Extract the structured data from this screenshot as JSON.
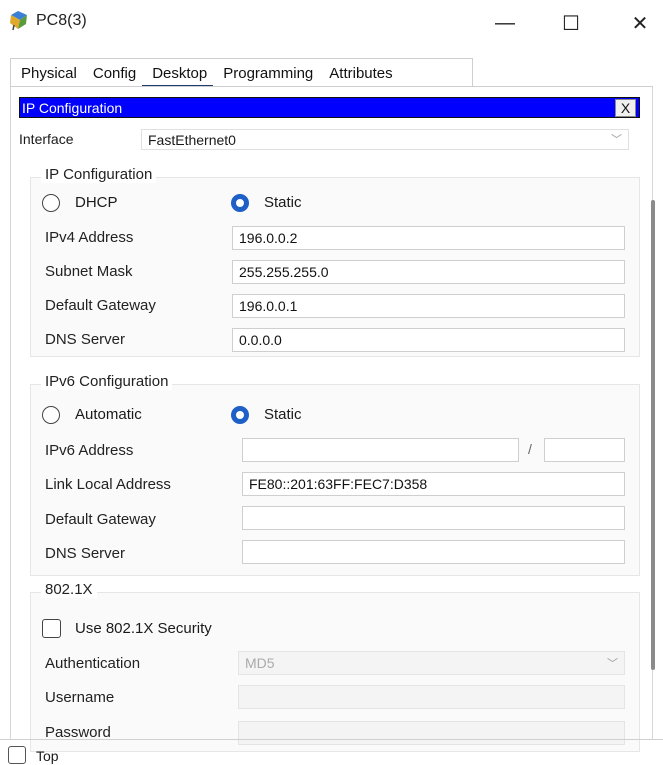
{
  "window": {
    "title": "PC8(3)",
    "minimize": "—",
    "maximize": "☐",
    "close": "✕"
  },
  "tabs": [
    {
      "label": "Physical"
    },
    {
      "label": "Config"
    },
    {
      "label": "Desktop"
    },
    {
      "label": "Programming"
    },
    {
      "label": "Attributes"
    }
  ],
  "active_tab": "Desktop",
  "panel": {
    "title": "IP Configuration",
    "close": "X",
    "interface_label": "Interface",
    "interface_value": "FastEthernet0"
  },
  "ipv4": {
    "legend": "IP Configuration",
    "dhcp_label": "DHCP",
    "static_label": "Static",
    "selected": "Static",
    "fields": [
      {
        "label": "IPv4 Address",
        "value": "196.0.0.2"
      },
      {
        "label": "Subnet Mask",
        "value": "255.255.255.0"
      },
      {
        "label": "Default Gateway",
        "value": "196.0.0.1"
      },
      {
        "label": "DNS Server",
        "value": "0.0.0.0"
      }
    ]
  },
  "ipv6": {
    "legend": "IPv6 Configuration",
    "auto_label": "Automatic",
    "static_label": "Static",
    "selected": "Static",
    "address_label": "IPv6 Address",
    "address_value": "",
    "prefix_sep": "/",
    "prefix_value": "",
    "link_local_label": "Link Local Address",
    "link_local_value": "FE80::201:63FF:FEC7:D358",
    "gateway_label": "Default Gateway",
    "gateway_value": "",
    "dns_label": "DNS Server",
    "dns_value": ""
  },
  "dot1x": {
    "legend": "802.1X",
    "use_label": "Use 802.1X Security",
    "checked": false,
    "auth_label": "Authentication",
    "auth_value": "MD5",
    "username_label": "Username",
    "password_label": "Password"
  },
  "footer": {
    "top_label": "Top",
    "checked": false
  }
}
